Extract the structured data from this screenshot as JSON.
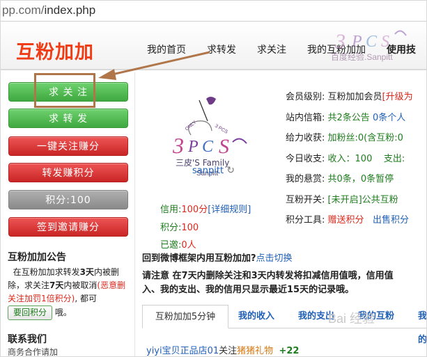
{
  "browser": {
    "url_dim": "pp.com/",
    "url_path": "index.php"
  },
  "header": {
    "brand": "互粉加加",
    "nav": [
      "我的首页",
      "求转发",
      "求关注",
      "我的互粉加加",
      "使用技"
    ],
    "watermark": "百度经验.Sanpitt"
  },
  "sidebar": {
    "buttons": [
      "求 关 注",
      "求 转 发",
      "一键关注赚分",
      "转发赚积分",
      "积分:100",
      "签到邀请赚分"
    ],
    "notice_title": "互粉加加公告",
    "notice_line1": "在互粉加加求转发",
    "notice_bold1": "3天",
    "notice_line2": "内被删除，求关注",
    "notice_bold2": "7天",
    "notice_line3": "内被取消",
    "notice_warn": "(恶意删关注加罚1倍积分)",
    "notice_line4": ", 都可",
    "notice_button": "要回积分",
    "notice_line5": "哦。",
    "contact_title": "联系我们",
    "contact_sub": "商务合作请加"
  },
  "profile": {
    "logo_only": "ONLY",
    "logo_3pcs": "3 PCS",
    "logo_name": "三皮'S Family",
    "logo_sub": "Sanpitt",
    "username": "sanpitt",
    "credit_label": "信用:",
    "credit_value": "100分",
    "credit_link": "[详细规则]",
    "points_label": "积分:",
    "points_value": "100",
    "invited_label": "已邀:",
    "invited_value": "0人"
  },
  "info": {
    "level_k": "会员级别:",
    "level_v": "互粉加加会员",
    "level_r": "[升级为",
    "mail_k": "站内信箱:",
    "mail_v": "共2条公告",
    "mail_b": "0条个人",
    "give_k": "给力收获:",
    "give_v": "加粉丝:0(含互粉:0",
    "today_k": "今日收支:",
    "today_v": "收入：100",
    "today_out": "支出:",
    "reward_k": "我的悬赏:",
    "reward_v": "共0条，",
    "reward_b": "0条暂停",
    "switch_k": "互粉开关:",
    "switch_v": "[未开启]公共互粉",
    "tools_k": "积分工具:",
    "tools_r": "赠送积分",
    "tools_b": "出售积分"
  },
  "main": {
    "switch_text": "回到微博框架内用互粉加加?",
    "switch_link": "点击切换",
    "note_line1": "请注意 在7天内删除关注和3天内转发将扣减信用值哦，信用值",
    "note_line2": "入、我的支出、我的信用只显示最近15天的记录哦。",
    "tabs": [
      "互粉加加5分钟",
      "我的收入",
      "我的支出",
      "我的互粉",
      "我的"
    ],
    "feed_user": "yiyi宝贝正品店01",
    "feed_action": "关注",
    "feed_target": "猪猪礼物",
    "feed_delta": "+22"
  },
  "overlay": {
    "watermark": "Bai 经验"
  },
  "colors": {
    "brand": "#ef3d17",
    "green": "#3fa83f",
    "red": "#c92525",
    "link": "#2160b7",
    "annotation": "#b0764a"
  }
}
